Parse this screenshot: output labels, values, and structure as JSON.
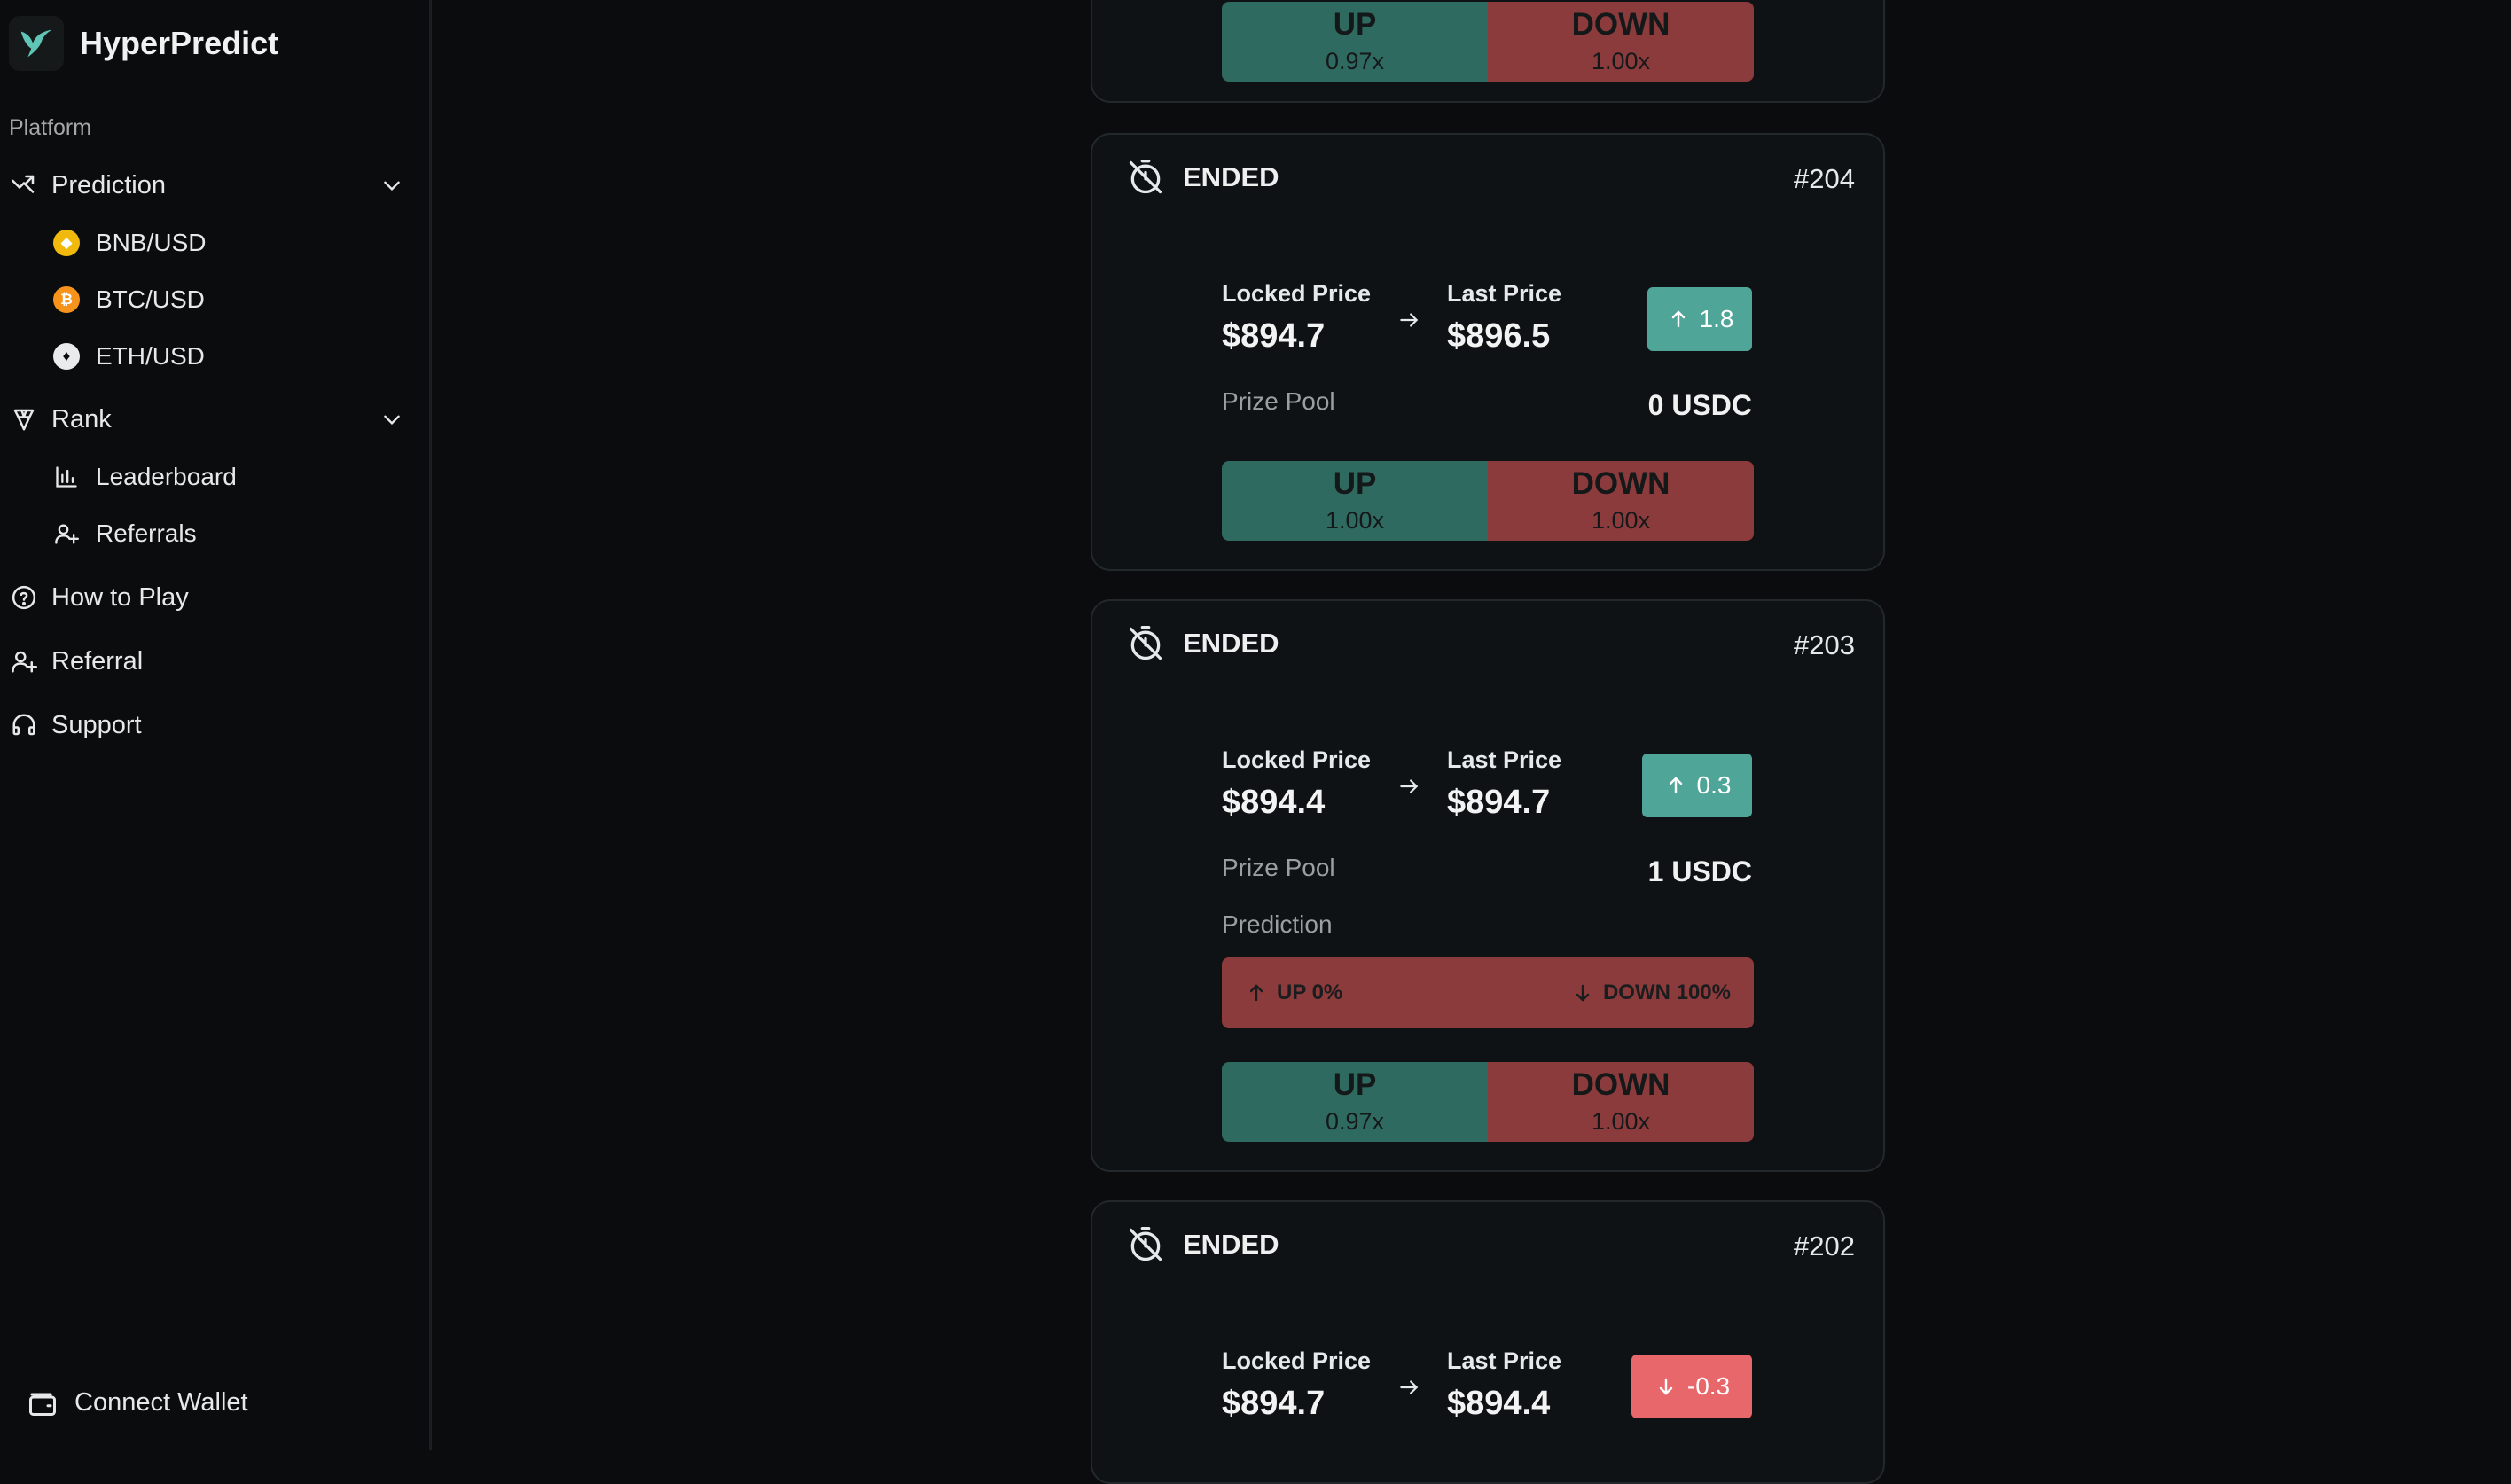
{
  "app": {
    "name": "HyperPredict"
  },
  "sidebar": {
    "section_label": "Platform",
    "prediction": {
      "label": "Prediction",
      "items": [
        {
          "label": "BNB/USD",
          "coin_color": "#f0b90b"
        },
        {
          "label": "BTC/USD",
          "coin_color": "#f7931a"
        },
        {
          "label": "ETH/USD",
          "coin_color": "#e9ecec"
        }
      ]
    },
    "rank": {
      "label": "Rank",
      "items": [
        {
          "label": "Leaderboard"
        },
        {
          "label": "Referrals"
        }
      ]
    },
    "links": [
      {
        "label": "How to Play"
      },
      {
        "label": "Referral"
      },
      {
        "label": "Support"
      }
    ],
    "connect_wallet": "Connect Wallet"
  },
  "labels": {
    "locked_price": "Locked Price",
    "last_price": "Last Price",
    "prize_pool": "Prize Pool",
    "prediction": "Prediction",
    "up": "UP",
    "down": "DOWN"
  },
  "colors": {
    "up": "#4ea598",
    "down": "#e8676a",
    "up_btn": "#2f6a61",
    "down_btn": "#8c3b3c"
  },
  "rounds": [
    {
      "up_multiplier": "0.97x",
      "down_multiplier": "1.00x"
    },
    {
      "status": "ENDED",
      "epoch": "#204",
      "locked_price": "$894.7",
      "last_price": "$896.5",
      "delta": "1.8",
      "delta_dir": "up",
      "prize_pool": "0 USDC",
      "up_multiplier": "1.00x",
      "down_multiplier": "1.00x"
    },
    {
      "status": "ENDED",
      "epoch": "#203",
      "locked_price": "$894.4",
      "last_price": "$894.7",
      "delta": "0.3",
      "delta_dir": "up",
      "prize_pool": "1 USDC",
      "prediction_up": "UP 0%",
      "prediction_down": "DOWN 100%",
      "up_multiplier": "0.97x",
      "down_multiplier": "1.00x"
    },
    {
      "status": "ENDED",
      "epoch": "#202",
      "locked_price": "$894.7",
      "last_price": "$894.4",
      "delta": "-0.3",
      "delta_dir": "down"
    }
  ]
}
